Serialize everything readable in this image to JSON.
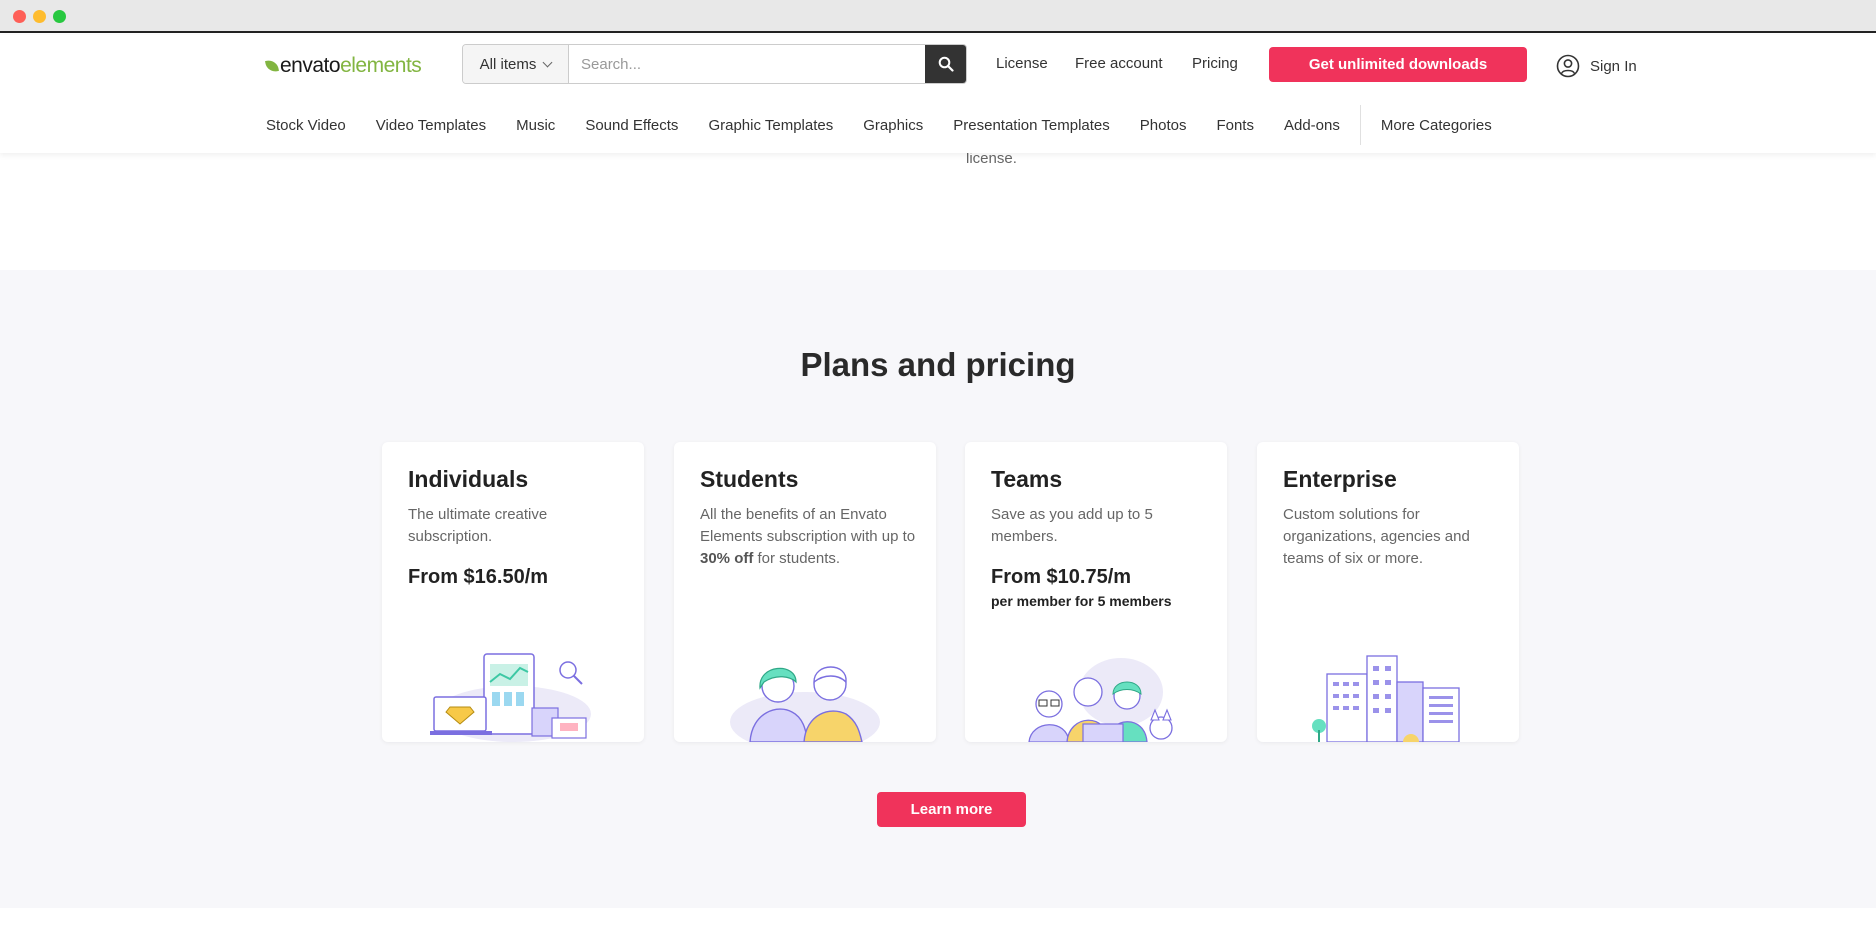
{
  "header": {
    "logo_primary": "envato",
    "logo_secondary": "elements",
    "search": {
      "category_label": "All items",
      "placeholder": "Search..."
    },
    "links": {
      "license": "License",
      "free_account": "Free account",
      "pricing": "Pricing"
    },
    "cta_label": "Get unlimited downloads",
    "sign_in": "Sign In",
    "categories": [
      "Stock Video",
      "Video Templates",
      "Music",
      "Sound Effects",
      "Graphic Templates",
      "Graphics",
      "Presentation Templates",
      "Photos",
      "Fonts",
      "Add-ons"
    ],
    "more_categories": "More Categories"
  },
  "license_fragment": "license.",
  "plans": {
    "title": "Plans and pricing",
    "cards": [
      {
        "title": "Individuals",
        "desc": "The ultimate creative subscription.",
        "price": "From $16.50/m"
      },
      {
        "title": "Students",
        "desc_before": "All the benefits of an Envato Elements subscription with up to ",
        "desc_bold": "30% off",
        "desc_after": " for students."
      },
      {
        "title": "Teams",
        "desc": "Save as you add up to 5 members.",
        "price": "From $10.75/m",
        "price_sub": "per member for 5 members"
      },
      {
        "title": "Enterprise",
        "desc": "Custom solutions for organizations, agencies and teams of six or more."
      }
    ],
    "learn_more": "Learn more"
  },
  "colors": {
    "brand_green": "#82b541",
    "cta_red": "#f0335b",
    "section_bg": "#f7f7fa"
  },
  "icons": {
    "search_button": "search-icon",
    "sign_in": "user-circle-icon",
    "dropdown": "chevron-down-icon"
  }
}
